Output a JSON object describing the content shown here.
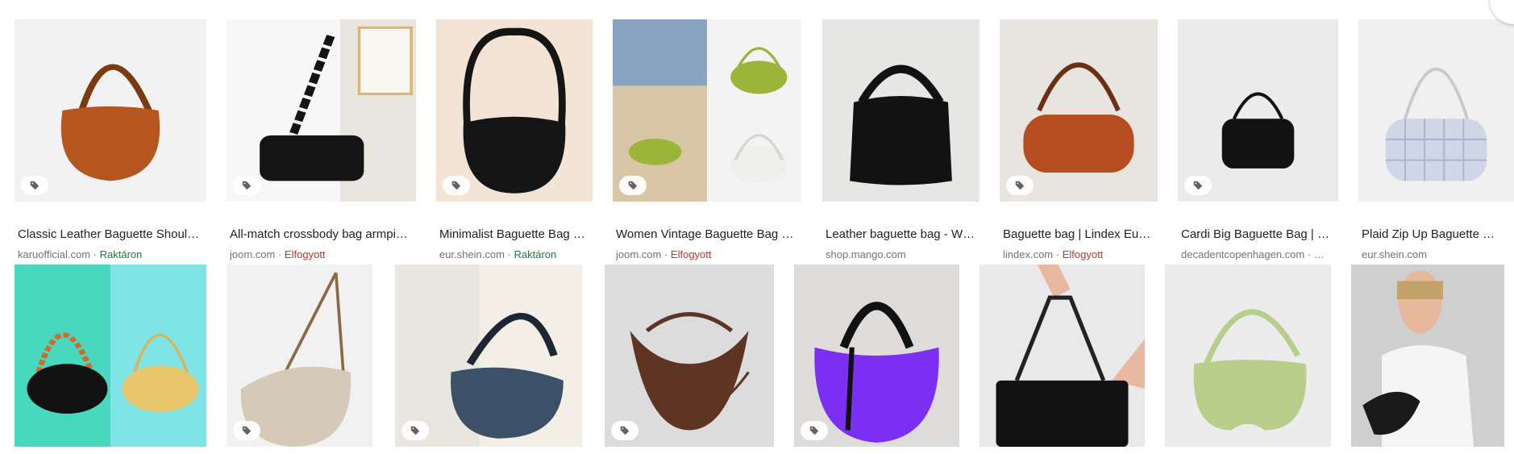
{
  "results": [
    {
      "title": "Classic Leather Baguette Shoul…",
      "source": "karuofficial.com",
      "status": "Raktáron",
      "status_type": "in",
      "bg": "#f2f2f2",
      "bag": "#b5561e",
      "shape": "baguette",
      "tag": true
    },
    {
      "title": "All-match crossbody bag armpi…",
      "source": "joom.com",
      "status": "Elfogyott",
      "status_type": "out",
      "bg": "#e9e5df",
      "bag": "#141414",
      "shape": "photo-chain",
      "tag": true
    },
    {
      "title": "Minimalist Baguette Bag …",
      "source": "eur.shein.com",
      "status": "Raktáron",
      "status_type": "in",
      "bg": "#f3e4d5",
      "bag": "#151515",
      "shape": "hobo",
      "tag": true
    },
    {
      "title": "Women Vintage Baguette Bag …",
      "source": "joom.com",
      "status": "Elfogyott",
      "status_type": "out",
      "bg": "#f3f3f3",
      "bag": "#9bb53a",
      "shape": "collage",
      "tag": true
    },
    {
      "title": "Leather baguette bag - W…",
      "source": "shop.mango.com",
      "status": "",
      "status_type": "",
      "bg": "#e6e6e4",
      "bag": "#121212",
      "shape": "hobo-short",
      "tag": false
    },
    {
      "title": "Baguette bag | Lindex Eu…",
      "source": "lindex.com",
      "status": "Elfogyott",
      "status_type": "out",
      "bg": "#e8e5e1",
      "bag": "#b64d20",
      "shape": "baguette-long",
      "tag": true
    },
    {
      "title": "Cardi Big Baguette Bag | …",
      "source": "decadentcopenhagen.com · …",
      "status": "",
      "status_type": "",
      "bg": "#ebebeb",
      "bag": "#121212",
      "shape": "small",
      "tag": true
    },
    {
      "title": "Plaid Zip Up Baguette …",
      "source": "eur.shein.com",
      "status": "",
      "status_type": "",
      "bg": "#f0f0f0",
      "bag": "#cfd6e6",
      "shape": "plaid",
      "tag": false
    },
    {
      "bg": "#47d8bd",
      "bag": "#111111",
      "shape": "duo",
      "tag": false
    },
    {
      "bg": "#f1f1f1",
      "bag": "#d5c9b7",
      "shape": "crossbody",
      "tag": true
    },
    {
      "bg": "#ece8e2",
      "bag": "#3c5068",
      "shape": "photo-held",
      "tag": true
    },
    {
      "bg": "#dcdcdc",
      "bag": "#5e3522",
      "shape": "crescent",
      "tag": true
    },
    {
      "bg": "#dedcdb",
      "bag": "#7b2ff2",
      "shape": "purple",
      "tag": true
    },
    {
      "bg": "#e9e9e9",
      "bag": "#111111",
      "shape": "hand",
      "tag": false
    },
    {
      "bg": "#ececec",
      "bag": "#b7cf8a",
      "shape": "croc",
      "tag": false
    },
    {
      "bg": "#c9c9c9",
      "bag": "#1a1a1a",
      "shape": "model",
      "tag": false
    }
  ],
  "icons": {
    "tag": "price-tag-icon"
  }
}
